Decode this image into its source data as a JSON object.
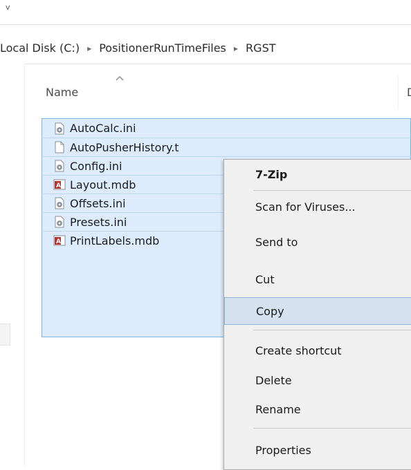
{
  "top_mark": "v",
  "breadcrumb": {
    "items": [
      "Local Disk (C:)",
      "PositionerRunTimeFiles",
      "RGST"
    ]
  },
  "columns": {
    "name": "Name",
    "second": "D"
  },
  "files": [
    {
      "name": "AutoCalc.ini",
      "icon": "settings-file-icon"
    },
    {
      "name": "AutoPusherHistory.t",
      "icon": "text-file-icon"
    },
    {
      "name": "Config.ini",
      "icon": "settings-file-icon"
    },
    {
      "name": "Layout.mdb",
      "icon": "access-db-icon"
    },
    {
      "name": "Offsets.ini",
      "icon": "settings-file-icon"
    },
    {
      "name": "Presets.ini",
      "icon": "settings-file-icon"
    },
    {
      "name": "PrintLabels.mdb",
      "icon": "access-db-icon"
    }
  ],
  "context_menu": {
    "items": [
      {
        "label": "7-Zip",
        "bold": true
      },
      {
        "label": "Scan for Viruses..."
      },
      {
        "label": "Send to"
      },
      {
        "label": "Cut"
      },
      {
        "label": "Copy",
        "hover": true
      },
      {
        "label": "Create shortcut"
      },
      {
        "label": "Delete"
      },
      {
        "label": "Rename"
      },
      {
        "label": "Properties"
      }
    ]
  },
  "colors": {
    "selection_bg": "#dcecfc",
    "selection_border": "#7bb2e4",
    "menu_bg": "#f0f0f0",
    "menu_hover": "#d4e1ee"
  }
}
